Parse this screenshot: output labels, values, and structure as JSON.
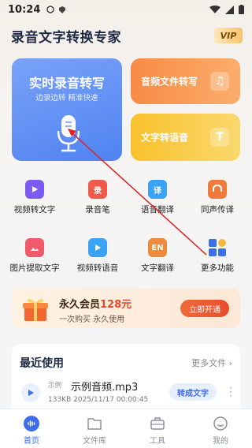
{
  "status": {
    "time": "10:24"
  },
  "header": {
    "title": "录音文字转换专家",
    "vip_label": "VIP"
  },
  "cards": {
    "realtime": {
      "title": "实时录音转写",
      "subtitle": "边录边转 精准快速"
    },
    "audio_file": {
      "title": "音频文件转写"
    },
    "text_to_speech": {
      "title": "文字转语音"
    }
  },
  "tools": [
    {
      "label": "视频转文字",
      "icon": "video-to-text-icon",
      "color": "#7c5cf0"
    },
    {
      "label": "录音笔",
      "icon": "recorder-icon",
      "color": "#f05a4a",
      "glyph": "录"
    },
    {
      "label": "语音翻译",
      "icon": "voice-translate-icon",
      "color": "#3aa3f5",
      "glyph": "译"
    },
    {
      "label": "同声传译",
      "icon": "interpretation-icon",
      "color": "#f07a3a"
    },
    {
      "label": "图片提取文字",
      "icon": "image-extract-icon",
      "color": "#f05a6a"
    },
    {
      "label": "视频转语音",
      "icon": "video-to-voice-icon",
      "color": "#3aa3f5"
    },
    {
      "label": "文字翻译",
      "icon": "text-translate-icon",
      "color": "#f08a3a",
      "glyph": "EN"
    },
    {
      "label": "更多功能",
      "icon": "more-features-icon",
      "color": "#3d6ee8"
    }
  ],
  "promo": {
    "title_prefix": "永久会员",
    "price": "128元",
    "subtitle": "一次购买 永久使用",
    "button": "立即开通"
  },
  "recent": {
    "heading": "最近使用",
    "more": "更多文件",
    "file": {
      "tag": "示例",
      "name": "示例音频.mp3",
      "meta": "133KB 2025/11/17 00:00:45",
      "action": "转成文字"
    }
  },
  "tabbar": [
    {
      "label": "首页",
      "icon": "home-wave-icon"
    },
    {
      "label": "文件库",
      "icon": "folder-icon"
    },
    {
      "label": "工具",
      "icon": "toolbox-icon"
    },
    {
      "label": "我的",
      "icon": "profile-icon"
    }
  ]
}
